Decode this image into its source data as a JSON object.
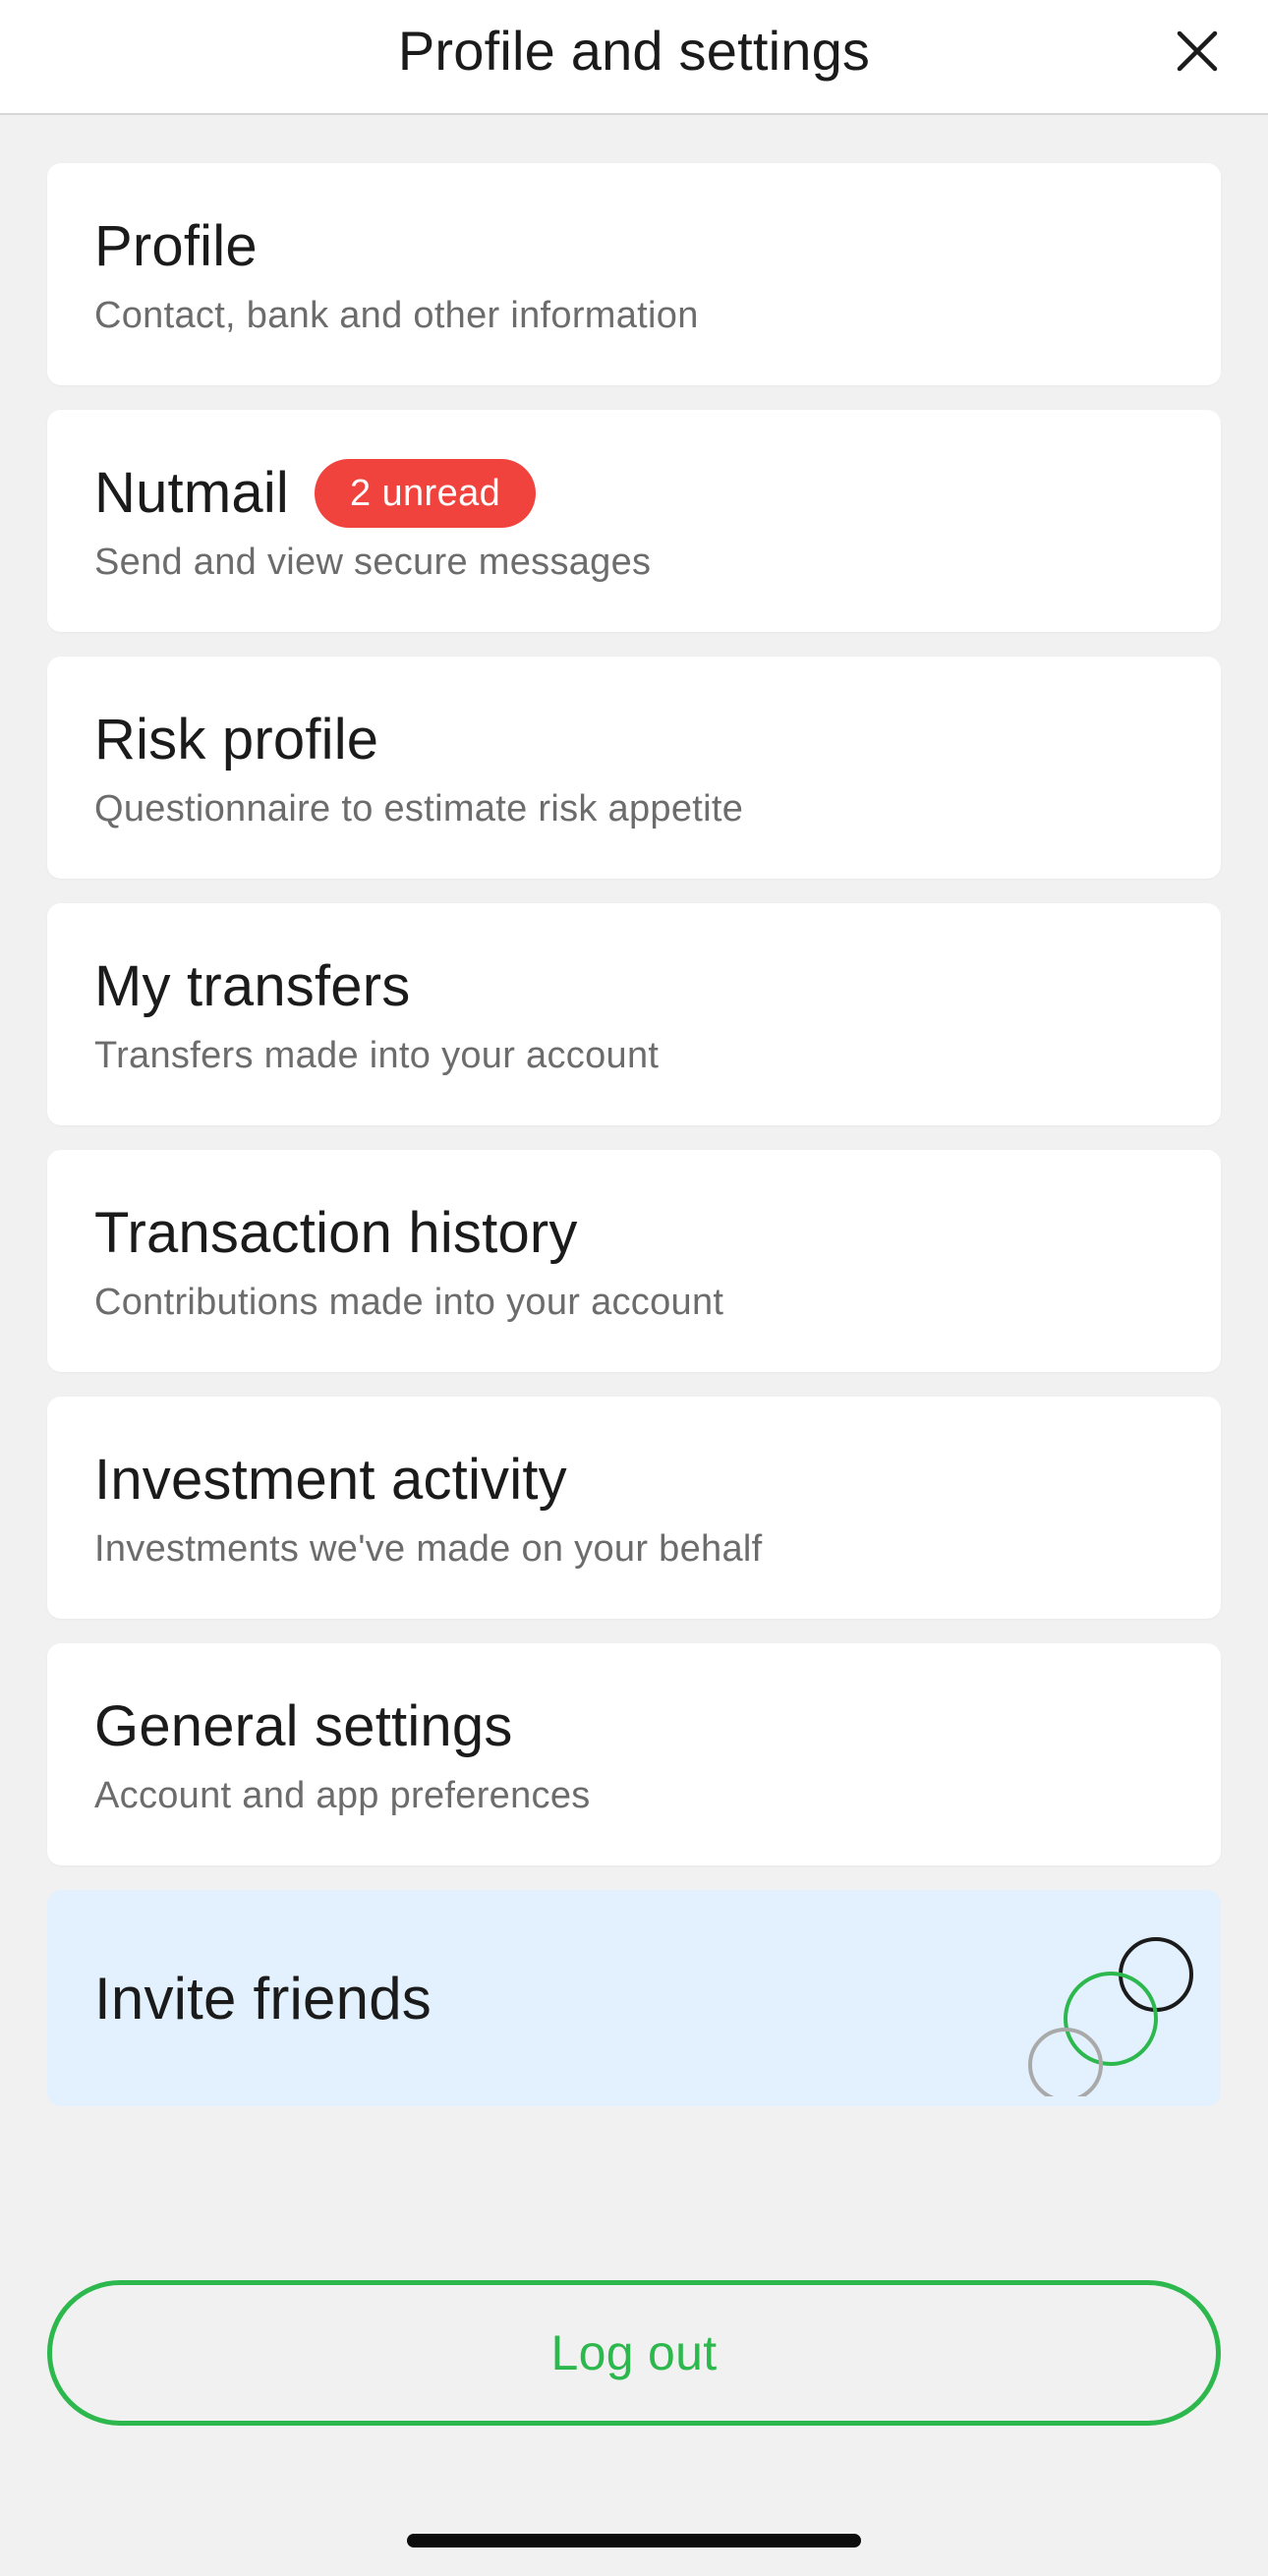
{
  "header": {
    "title": "Profile and settings",
    "close_icon": "close-icon"
  },
  "menu": {
    "items": [
      {
        "title": "Profile",
        "subtitle": "Contact, bank and other information"
      },
      {
        "title": "Nutmail",
        "subtitle": "Send and view secure messages",
        "badge": "2 unread"
      },
      {
        "title": "Risk profile",
        "subtitle": "Questionnaire to estimate risk appetite"
      },
      {
        "title": "My transfers",
        "subtitle": "Transfers made into your account"
      },
      {
        "title": "Transaction history",
        "subtitle": "Contributions made into your account"
      },
      {
        "title": "Investment activity",
        "subtitle": "Investments we've made on your behalf"
      },
      {
        "title": "General settings",
        "subtitle": "Account and app preferences"
      }
    ]
  },
  "invite": {
    "title": "Invite friends",
    "icon": "invite-circles-icon"
  },
  "logout": {
    "label": "Log out"
  },
  "colors": {
    "accent": "#2db84e",
    "badge": "#f1433d",
    "invite_bg": "#e2f1fd",
    "page_bg": "#f1f1f1"
  }
}
